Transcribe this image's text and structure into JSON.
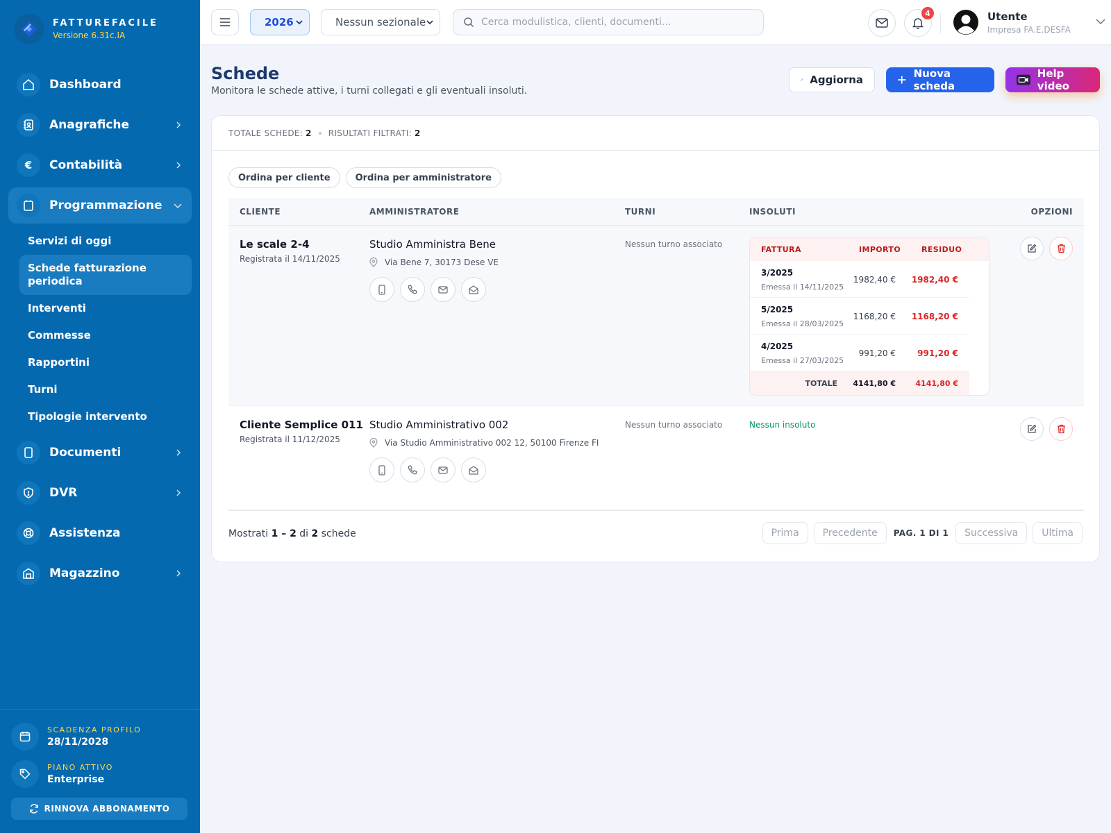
{
  "app": {
    "name": "FATTUREFACILE",
    "version": "Versione 6.31c.IA"
  },
  "sidebar": {
    "items": [
      {
        "label": "Dashboard",
        "icon": "home-icon"
      },
      {
        "label": "Anagrafiche",
        "icon": "address-book-icon"
      },
      {
        "label": "Contabilità",
        "icon": "euro-icon"
      },
      {
        "label": "Programmazione",
        "icon": "calendar-icon"
      },
      {
        "label": "Documenti",
        "icon": "document-icon"
      },
      {
        "label": "DVR",
        "icon": "shield-icon"
      },
      {
        "label": "Assistenza",
        "icon": "lifebuoy-icon"
      },
      {
        "label": "Magazzino",
        "icon": "warehouse-icon"
      }
    ],
    "subitems": [
      {
        "label": "Servizi di oggi"
      },
      {
        "label": "Schede fatturazione periodica"
      },
      {
        "label": "Interventi"
      },
      {
        "label": "Commesse"
      },
      {
        "label": "Rapportini"
      },
      {
        "label": "Turni"
      },
      {
        "label": "Tipologie intervento"
      }
    ],
    "footer": {
      "expiry_label": "SCADENZA PROFILO",
      "expiry_value": "28/11/2028",
      "plan_label": "PIANO ATTIVO",
      "plan_value": "Enterprise",
      "renew_label": "RINNOVA ABBONAMENTO"
    }
  },
  "topbar": {
    "year": "2026",
    "sezionale": "Nessun sezionale",
    "search_placeholder": "Cerca modulistica, clienti, documenti...",
    "notifications_count": "4",
    "user_name": "Utente",
    "user_company": "Impresa FA.E.DESFA"
  },
  "page": {
    "title": "Schede",
    "subtitle": "Monitora le schede attive, i turni collegati e gli eventuali insoluti.",
    "refresh_label": "Aggiorna",
    "new_label": "Nuova scheda",
    "help_label": "Help video"
  },
  "stats": {
    "total_label": "TOTALE SCHEDE:",
    "total_value": "2",
    "filtered_label": "RISULTATI FILTRATI:",
    "filtered_value": "2"
  },
  "sort": {
    "by_client": "Ordina per cliente",
    "by_admin": "Ordina per amministratore"
  },
  "table": {
    "headers": {
      "client": "CLIENTE",
      "admin": "AMMINISTRATORE",
      "turni": "TURNI",
      "insoluti": "INSOLUTI",
      "options": "OPZIONI"
    },
    "rows": [
      {
        "client": "Le scale 2-4",
        "registered": "Registrata il 14/11/2025",
        "admin": "Studio Amministra Bene",
        "address": "Via Bene 7, 30173 Dese VE",
        "turni": "Nessun turno associato",
        "invoices": {
          "headers": {
            "invoice": "FATTURA",
            "amount": "IMPORTO",
            "residual": "RESIDUO"
          },
          "items": [
            {
              "number": "3/2025",
              "date": "Emessa il 14/11/2025",
              "amount": "1982,40 €",
              "residual": "1982,40 €"
            },
            {
              "number": "5/2025",
              "date": "Emessa il 28/03/2025",
              "amount": "1168,20 €",
              "residual": "1168,20 €"
            },
            {
              "number": "4/2025",
              "date": "Emessa il 27/03/2025",
              "amount": "991,20 €",
              "residual": "991,20 €"
            }
          ],
          "total_label": "TOTALE",
          "total_amount": "4141,80 €",
          "total_residual": "4141,80 €"
        }
      },
      {
        "client": "Cliente Semplice 011",
        "registered": "Registrata il 11/12/2025",
        "admin": "Studio Amministrativo 002",
        "address": "Via Studio Amministrativo 002 12, 50100 Firenze FI",
        "turni": "Nessun turno associato",
        "insoluti": "Nessun insoluto"
      }
    ]
  },
  "footer": {
    "shown_prefix": "Mostrati",
    "shown_range": "1 – 2",
    "shown_of": "di",
    "shown_total": "2",
    "shown_suffix": "schede",
    "first": "Prima",
    "prev": "Precedente",
    "page_info": "PAG. 1 DI 1",
    "next": "Successiva",
    "last": "Ultima"
  },
  "colors": {
    "sidebar": "#0569b0",
    "primary": "#2563eb",
    "danger": "#dc2626",
    "success": "#059669",
    "accent_yellow": "#ffd84d"
  }
}
